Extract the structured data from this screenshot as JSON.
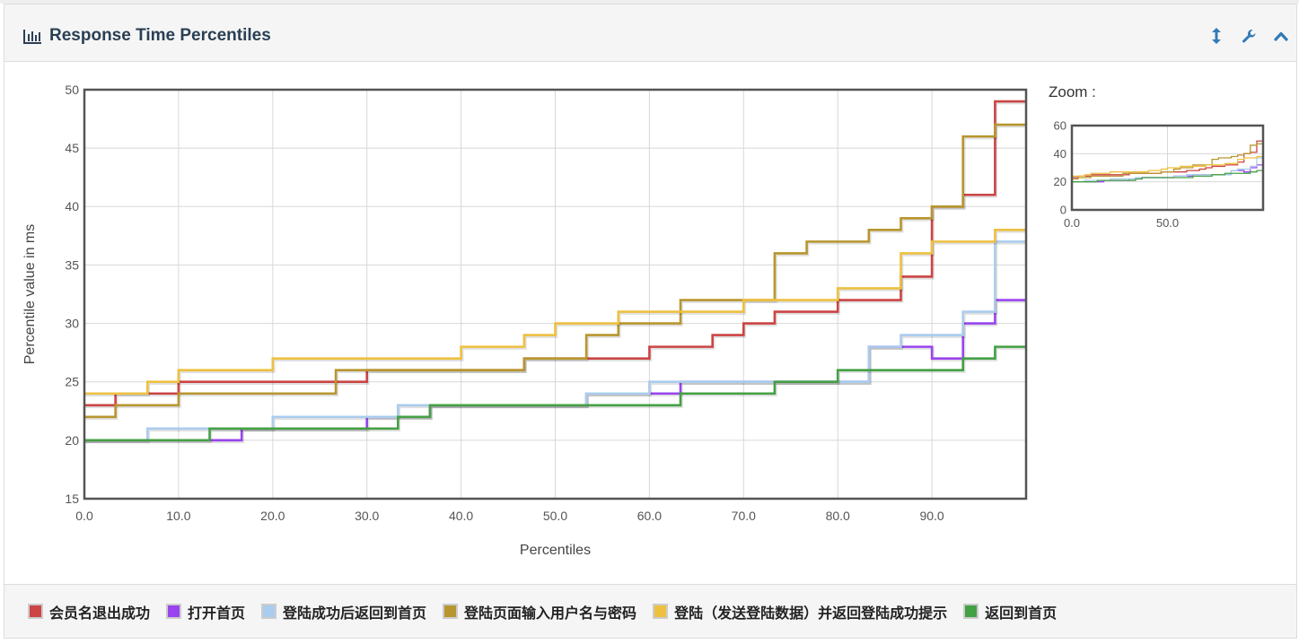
{
  "panel": {
    "title": "Response Time Percentiles",
    "icons": {
      "title_icon": "bar-chart-icon",
      "tools": [
        "resize-vertical-icon",
        "wrench-icon",
        "chevron-up-icon"
      ]
    },
    "zoom_label": "Zoom :"
  },
  "chart_data": [
    {
      "type": "line",
      "title": "",
      "xlabel": "Percentiles",
      "ylabel": "Percentile value in ms",
      "xlim": [
        0,
        100
      ],
      "ylim": [
        15,
        50
      ],
      "x_ticks": [
        0,
        10,
        20,
        30,
        40,
        50,
        60,
        70,
        80,
        90
      ],
      "x_tick_labels": [
        "0.0",
        "10.0",
        "20.0",
        "30.0",
        "40.0",
        "50.0",
        "60.0",
        "70.0",
        "80.0",
        "90.0"
      ],
      "y_ticks": [
        15,
        20,
        25,
        30,
        35,
        40,
        45,
        50
      ],
      "y_tick_labels": [
        "15",
        "20",
        "25",
        "30",
        "35",
        "40",
        "45",
        "50"
      ],
      "grid": true,
      "legend_position": "bottom",
      "step": true,
      "series": [
        {
          "name": "会员名退出成功",
          "color": "#cc4444",
          "x": [
            0,
            3.3,
            10,
            30,
            46.7,
            53.3,
            60,
            66.7,
            70,
            73.3,
            80,
            86.7,
            90,
            93.3,
            96.7
          ],
          "y": [
            23,
            24,
            25,
            26,
            27,
            27,
            28,
            29,
            30,
            31,
            32,
            34,
            40,
            41,
            49
          ]
        },
        {
          "name": "打开首页",
          "color": "#9944ee",
          "x": [
            0,
            16.7,
            30,
            33.3,
            36.7,
            53.3,
            60,
            63.3,
            73.3,
            83.3,
            90,
            93.3,
            96.7
          ],
          "y": [
            20,
            21,
            22,
            22,
            23,
            24,
            24,
            25,
            25,
            28,
            27,
            30,
            32
          ]
        },
        {
          "name": "登陆成功后返回到首页",
          "color": "#aaccee",
          "x": [
            0,
            6.7,
            20,
            33.3,
            53.3,
            60,
            73.3,
            83.3,
            86.7,
            93.3,
            96.7
          ],
          "y": [
            20,
            21,
            22,
            23,
            24,
            25,
            25,
            28,
            29,
            31,
            37
          ]
        },
        {
          "name": "登陆页面输入用户名与密码",
          "color": "#b8962e",
          "x": [
            0,
            3.3,
            10,
            26.7,
            46.7,
            53.3,
            56.7,
            63.3,
            73.3,
            76.7,
            83.3,
            86.7,
            90,
            93.3,
            96.7
          ],
          "y": [
            22,
            23,
            24,
            26,
            27,
            29,
            30,
            32,
            36,
            37,
            38,
            39,
            40,
            46,
            47
          ]
        },
        {
          "name": "登陆（发送登陆数据）并返回登陆成功提示",
          "color": "#eec040",
          "x": [
            0,
            6.7,
            10,
            20,
            40,
            46.7,
            50,
            56.7,
            63.3,
            70,
            80,
            86.7,
            90,
            96.7
          ],
          "y": [
            24,
            25,
            26,
            27,
            28,
            29,
            30,
            31,
            31,
            32,
            33,
            36,
            37,
            38
          ]
        },
        {
          "name": "返回到首页",
          "color": "#44a044",
          "x": [
            0,
            13.3,
            33.3,
            36.7,
            63.3,
            73.3,
            80,
            90,
            93.3,
            96.7
          ],
          "y": [
            20,
            21,
            22,
            23,
            24,
            25,
            26,
            26,
            27,
            28
          ]
        }
      ]
    },
    {
      "type": "line",
      "title": "",
      "xlim": [
        0,
        100
      ],
      "ylim": [
        0,
        60
      ],
      "x_ticks": [
        0,
        50
      ],
      "x_tick_labels": [
        "0.0",
        "50.0"
      ],
      "y_ticks": [
        0,
        20,
        40,
        60
      ],
      "y_tick_labels": [
        "0",
        "20",
        "40",
        "60"
      ],
      "grid": true,
      "step": true,
      "series": [
        {
          "name": "会员名退出成功",
          "color": "#cc4444",
          "x": [
            0,
            3.3,
            10,
            30,
            46.7,
            53.3,
            60,
            66.7,
            70,
            73.3,
            80,
            86.7,
            90,
            93.3,
            96.7
          ],
          "y": [
            23,
            24,
            25,
            26,
            27,
            27,
            28,
            29,
            30,
            31,
            32,
            34,
            40,
            41,
            49
          ]
        },
        {
          "name": "打开首页",
          "color": "#9944ee",
          "x": [
            0,
            16.7,
            30,
            33.3,
            36.7,
            53.3,
            60,
            63.3,
            73.3,
            83.3,
            90,
            93.3,
            96.7
          ],
          "y": [
            20,
            21,
            22,
            22,
            23,
            24,
            24,
            25,
            25,
            28,
            27,
            30,
            32
          ]
        },
        {
          "name": "登陆成功后返回到首页",
          "color": "#aaccee",
          "x": [
            0,
            6.7,
            20,
            33.3,
            53.3,
            60,
            73.3,
            83.3,
            86.7,
            93.3,
            96.7
          ],
          "y": [
            20,
            21,
            22,
            23,
            24,
            25,
            25,
            28,
            29,
            31,
            37
          ]
        },
        {
          "name": "登陆页面输入用户名与密码",
          "color": "#b8962e",
          "x": [
            0,
            3.3,
            10,
            26.7,
            46.7,
            53.3,
            56.7,
            63.3,
            73.3,
            76.7,
            83.3,
            86.7,
            90,
            93.3,
            96.7
          ],
          "y": [
            22,
            23,
            24,
            26,
            27,
            29,
            30,
            32,
            36,
            37,
            38,
            39,
            40,
            46,
            47
          ]
        },
        {
          "name": "登陆（发送登陆数据）并返回登陆成功提示",
          "color": "#eec040",
          "x": [
            0,
            6.7,
            10,
            20,
            40,
            46.7,
            50,
            56.7,
            63.3,
            70,
            80,
            86.7,
            90,
            96.7
          ],
          "y": [
            24,
            25,
            26,
            27,
            28,
            29,
            30,
            31,
            31,
            32,
            33,
            36,
            37,
            38
          ]
        },
        {
          "name": "返回到首页",
          "color": "#44a044",
          "x": [
            0,
            13.3,
            33.3,
            36.7,
            63.3,
            73.3,
            80,
            90,
            93.3,
            96.7
          ],
          "y": [
            20,
            21,
            22,
            23,
            24,
            25,
            26,
            26,
            27,
            28
          ]
        }
      ]
    }
  ],
  "legend": [
    {
      "label": "会员名退出成功",
      "color": "#cc4444"
    },
    {
      "label": "打开首页",
      "color": "#9944ee"
    },
    {
      "label": "登陆成功后返回到首页",
      "color": "#aaccee"
    },
    {
      "label": "登陆页面输入用户名与密码",
      "color": "#b8962e"
    },
    {
      "label": "登陆（发送登陆数据）并返回登陆成功提示",
      "color": "#eec040"
    },
    {
      "label": "返回到首页",
      "color": "#44a044"
    }
  ]
}
